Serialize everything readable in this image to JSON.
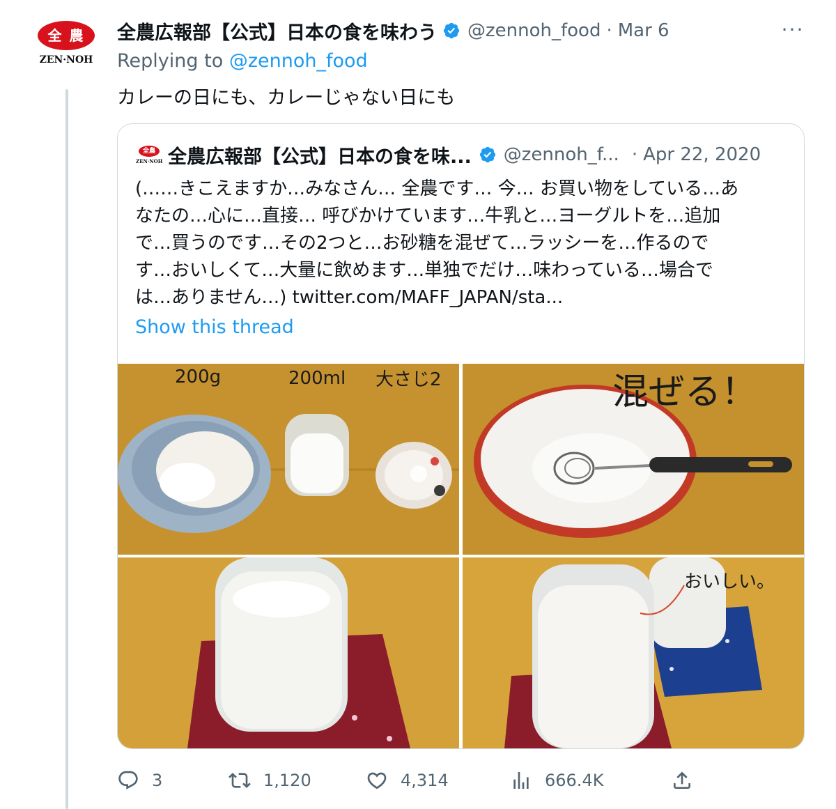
{
  "tweet": {
    "author": {
      "display_name": "全農広報部【公式】日本の食を味わう",
      "handle": "@zennoh_food",
      "date": "Mar 6",
      "avatar_mark": "全 農",
      "avatar_brand": "ZEN·NOH",
      "verified_icon": "verified-badge-icon"
    },
    "separator": "·",
    "more_icon": "···",
    "replying_prefix": "Replying to",
    "replying_to": "@zennoh_food",
    "text": "カレーの日にも、カレーじゃない日にも"
  },
  "quote": {
    "author": {
      "display_name": "全農広報部【公式】日本の食を味...",
      "handle": "@zennoh_f...",
      "date": "Apr 22, 2020",
      "avatar_mark": "全農",
      "avatar_brand": "ZEN·NOH"
    },
    "separator": "·",
    "body_lines": [
      "(……きこえますか…みなさん… 全農です… 今… お買い物をしている…あ",
      "なたの…心に…直接… 呼びかけています…牛乳と…ヨーグルトを…追加",
      "で…買うのです…その2つと…お砂糖を混ぜて…ラッシーを…作るので",
      "す…おいしくて…大量に飲めます…単独でだけ…味わっている…場合で",
      "は…ありません…) twitter.com/MAFF_JAPAN/sta..."
    ],
    "show_thread": "Show this thread",
    "images": [
      {
        "labels": [
          "200g",
          "200ml",
          "大さじ2"
        ]
      },
      {
        "labels": [
          "混ぜる！"
        ]
      },
      {
        "labels": []
      },
      {
        "labels": [
          "おいしい。"
        ]
      }
    ]
  },
  "actions": {
    "reply": {
      "icon": "reply-icon",
      "count": "3"
    },
    "retweet": {
      "icon": "retweet-icon",
      "count": "1,120"
    },
    "like": {
      "icon": "heart-icon",
      "count": "4,314"
    },
    "views": {
      "icon": "analytics-icon",
      "count": "666.4K"
    },
    "share": {
      "icon": "share-icon"
    }
  },
  "colors": {
    "accent": "#1d9bf0",
    "secondary_text": "#536471",
    "brand_red": "#d8121c",
    "border": "#cfd9de"
  }
}
